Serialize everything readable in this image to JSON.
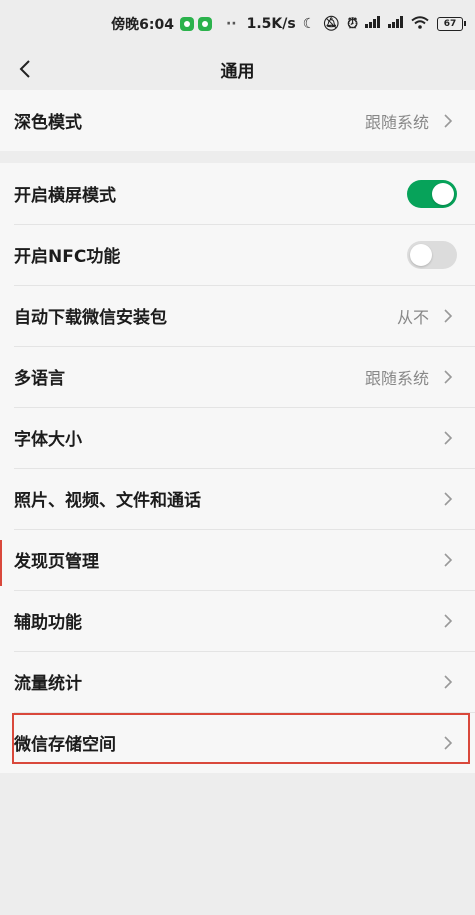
{
  "status": {
    "time": "傍晚6:04",
    "separator": "··",
    "speed": "1.5K/s",
    "battery": "67",
    "accent": "#2bb24c"
  },
  "nav": {
    "title": "通用",
    "back_icon": "chevron-left-icon"
  },
  "settings": {
    "dark_mode": {
      "label": "深色模式",
      "value": "跟随系统"
    },
    "landscape": {
      "label": "开启横屏模式",
      "enabled": true
    },
    "nfc": {
      "label": "开启NFC功能",
      "enabled": false
    },
    "auto_download": {
      "label": "自动下载微信安装包",
      "value": "从不"
    },
    "language": {
      "label": "多语言",
      "value": "跟随系统"
    },
    "font_size": {
      "label": "字体大小"
    },
    "media": {
      "label": "照片、视频、文件和通话"
    },
    "discover": {
      "label": "发现页管理"
    },
    "accessibility": {
      "label": "辅助功能"
    },
    "traffic": {
      "label": "流量统计"
    },
    "storage": {
      "label": "微信存储空间"
    }
  },
  "colors": {
    "toggle_on": "#07a35a",
    "toggle_off": "#dcdcdc",
    "highlight": "#d9483b"
  }
}
